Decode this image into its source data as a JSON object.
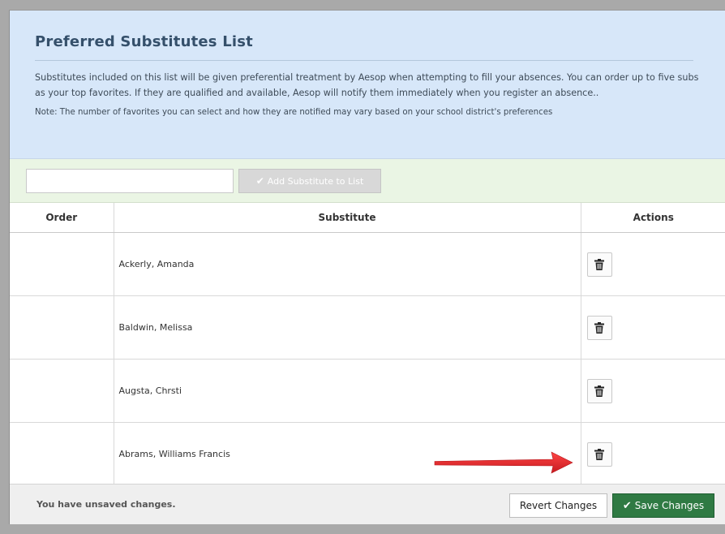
{
  "header": {
    "title": "Preferred Substitutes List",
    "description": "Substitutes included on this list will be given preferential treatment by Aesop when attempting to fill your absences. You can order up to five subs as your top favorites. If they are qualified and available, Aesop will notify them immediately when you register an absence..",
    "note": "Note: The number of favorites you can select and how they are notified may vary based on your school district's preferences"
  },
  "add_bar": {
    "input_value": "",
    "input_placeholder": "",
    "add_button_label": "Add Substitute to List"
  },
  "table": {
    "columns": [
      "Order",
      "Substitute",
      "Actions"
    ],
    "rows": [
      {
        "order": "",
        "substitute": "Ackerly, Amanda"
      },
      {
        "order": "",
        "substitute": "Baldwin, Melissa"
      },
      {
        "order": "",
        "substitute": "Augsta, Chrsti"
      },
      {
        "order": "",
        "substitute": "Abrams, Williams Francis"
      }
    ]
  },
  "footer": {
    "status": "You have unsaved changes.",
    "revert_label": "Revert Changes",
    "save_label": "Save Changes"
  },
  "icons": {
    "delete": "trash-icon",
    "check": "check-icon",
    "annotation": "red-arrow"
  },
  "colors": {
    "header_bg": "#d7e7f9",
    "add_bar_bg": "#eaf5e4",
    "save_button": "#2f7a43",
    "arrow": "#e8191f"
  }
}
